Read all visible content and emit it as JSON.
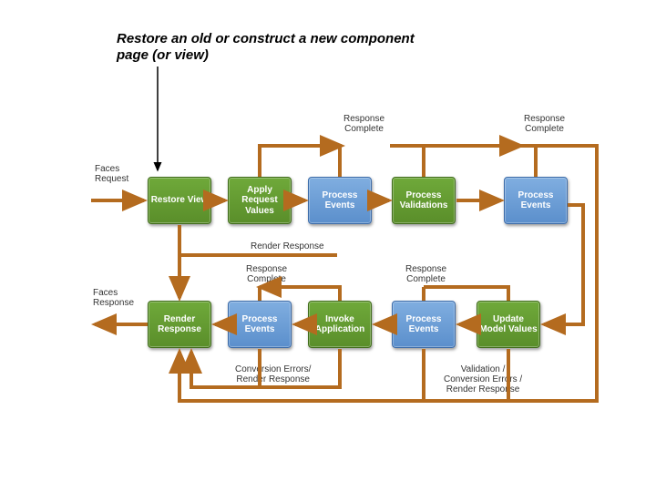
{
  "title": "Restore an old or construct a new component page (or view)",
  "labels": {
    "faces_request": "Faces\nRequest",
    "faces_response": "Faces\nResponse",
    "response_complete_1": "Response\nComplete",
    "response_complete_2": "Response\nComplete",
    "response_complete_3": "Response\nComplete",
    "response_complete_4": "Response\nComplete",
    "render_response_mid": "Render Response",
    "conversion_errors": "Conversion Errors/\nRender Response",
    "validation_errors": "Validation /\nConversion Errors /\nRender Response"
  },
  "boxes": {
    "restore_view": "Restore\nView",
    "apply_request": "Apply\nRequest\nValues",
    "process_events_1": "Process\nEvents",
    "process_validations": "Process\nValidations",
    "process_events_2": "Process\nEvents",
    "render_response": "Render\nResponse",
    "process_events_3": "Process\nEvents",
    "invoke_application": "Invoke\nApplication",
    "process_events_4": "Process\nEvents",
    "update_model": "Update\nModel\nValues"
  }
}
